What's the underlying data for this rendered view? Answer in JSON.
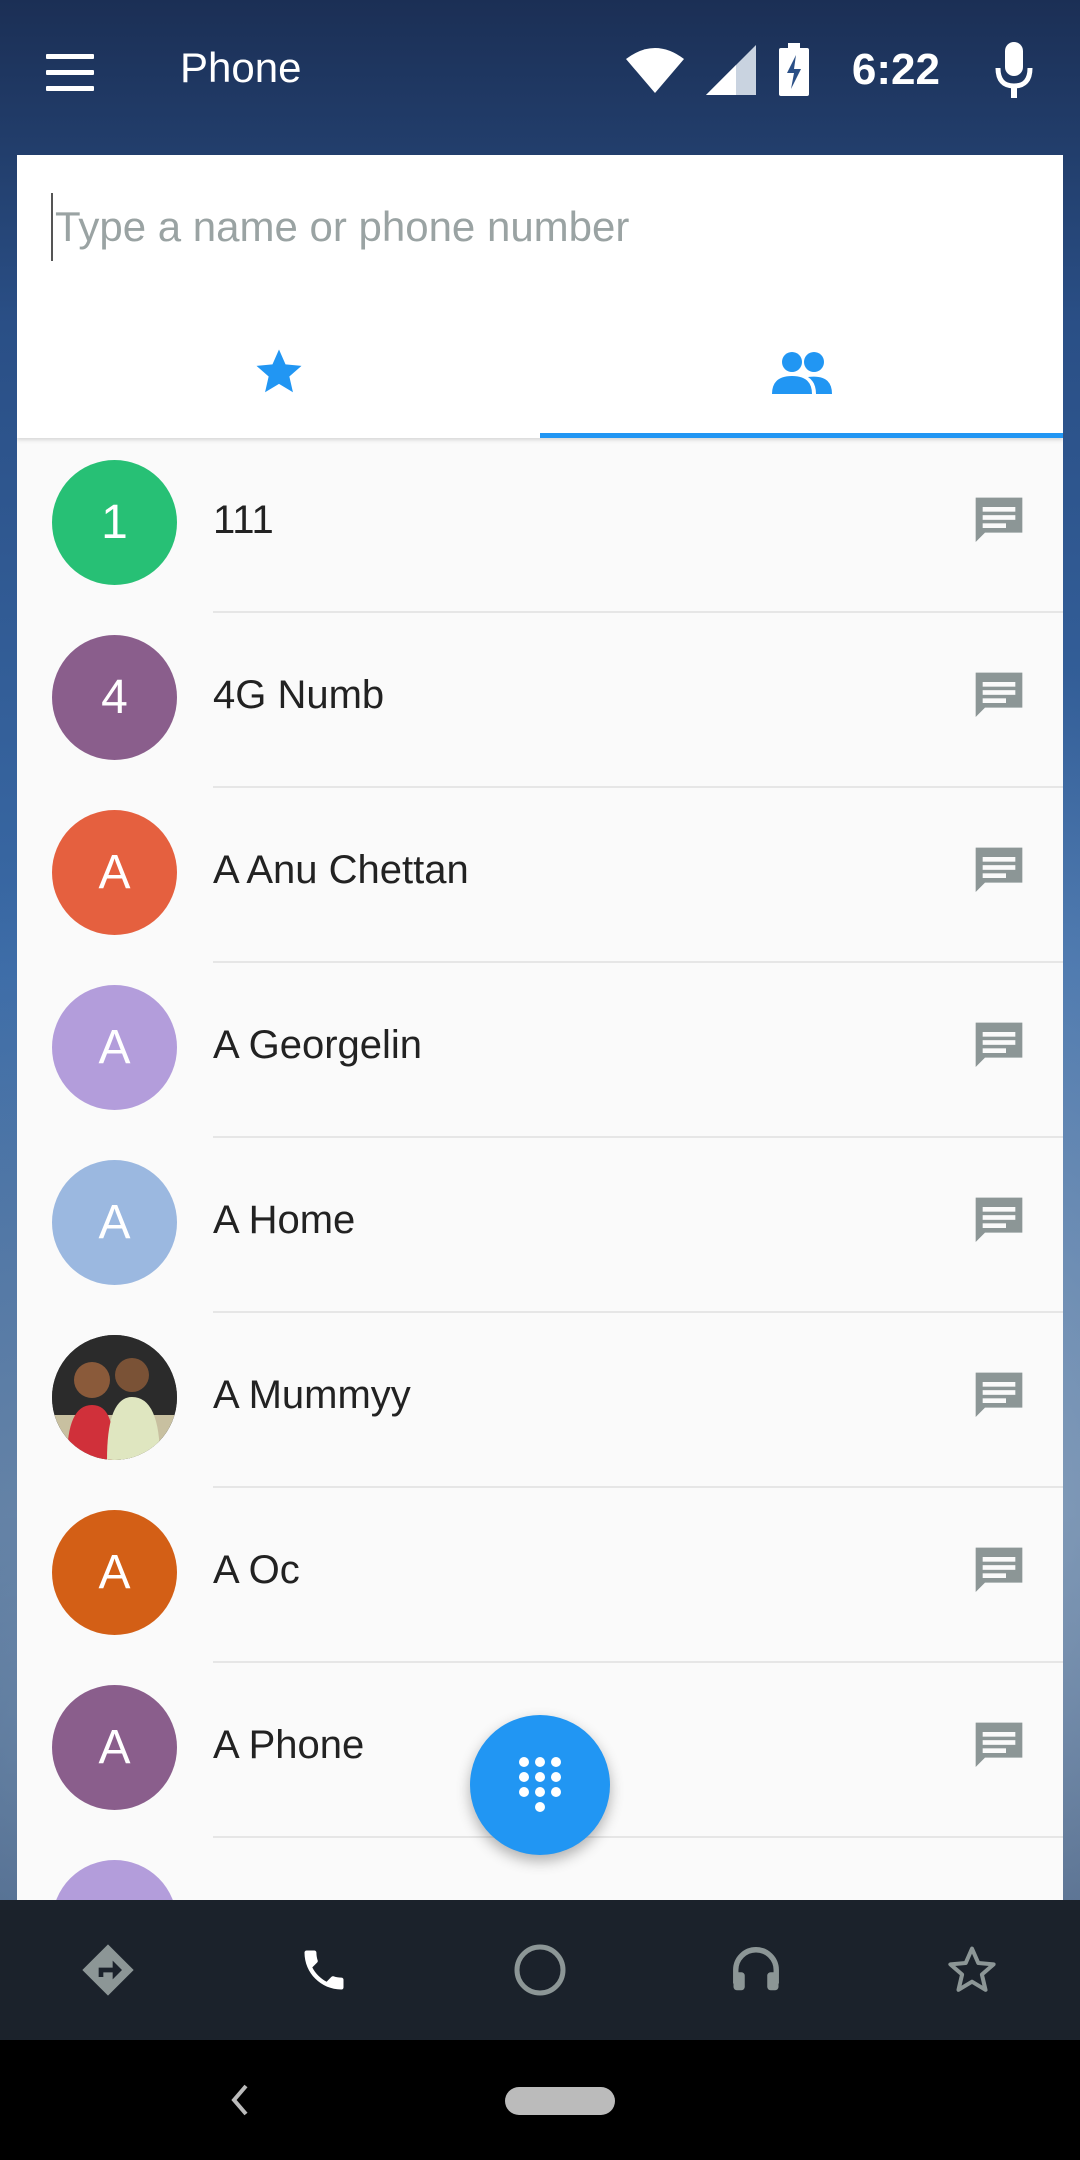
{
  "app": {
    "title": "Phone"
  },
  "status": {
    "time": "6:22"
  },
  "search": {
    "placeholder": "Type a name or phone number",
    "value": ""
  },
  "tabs": [
    {
      "icon": "star-icon",
      "active": false
    },
    {
      "icon": "contacts-icon",
      "active": true
    }
  ],
  "contacts": [
    {
      "name": "111",
      "initial": "1",
      "color": "#27c075"
    },
    {
      "name": "4G Numb",
      "initial": "4",
      "color": "#8a5e8c"
    },
    {
      "name": "A Anu Chettan",
      "initial": "A",
      "color": "#e5603f"
    },
    {
      "name": "A Georgelin",
      "initial": "A",
      "color": "#b39ddb"
    },
    {
      "name": "A Home",
      "initial": "A",
      "color": "#9bb8e0"
    },
    {
      "name": "A Mummyy",
      "initial": "",
      "color": "#3a3a3a",
      "photo": true
    },
    {
      "name": "A Oc",
      "initial": "A",
      "color": "#d35f16"
    },
    {
      "name": "A Phone",
      "initial": "A",
      "color": "#8a5e8c"
    },
    {
      "name": "",
      "initial": "",
      "color": "#b39ddb"
    }
  ],
  "colors": {
    "accent": "#2196f3",
    "icon_gray": "#8c9696",
    "bottombar": "#1b222b"
  },
  "bottom_nav": [
    "navigation-icon",
    "phone-icon",
    "circle-home-icon",
    "headphones-icon",
    "star-outline-icon"
  ]
}
